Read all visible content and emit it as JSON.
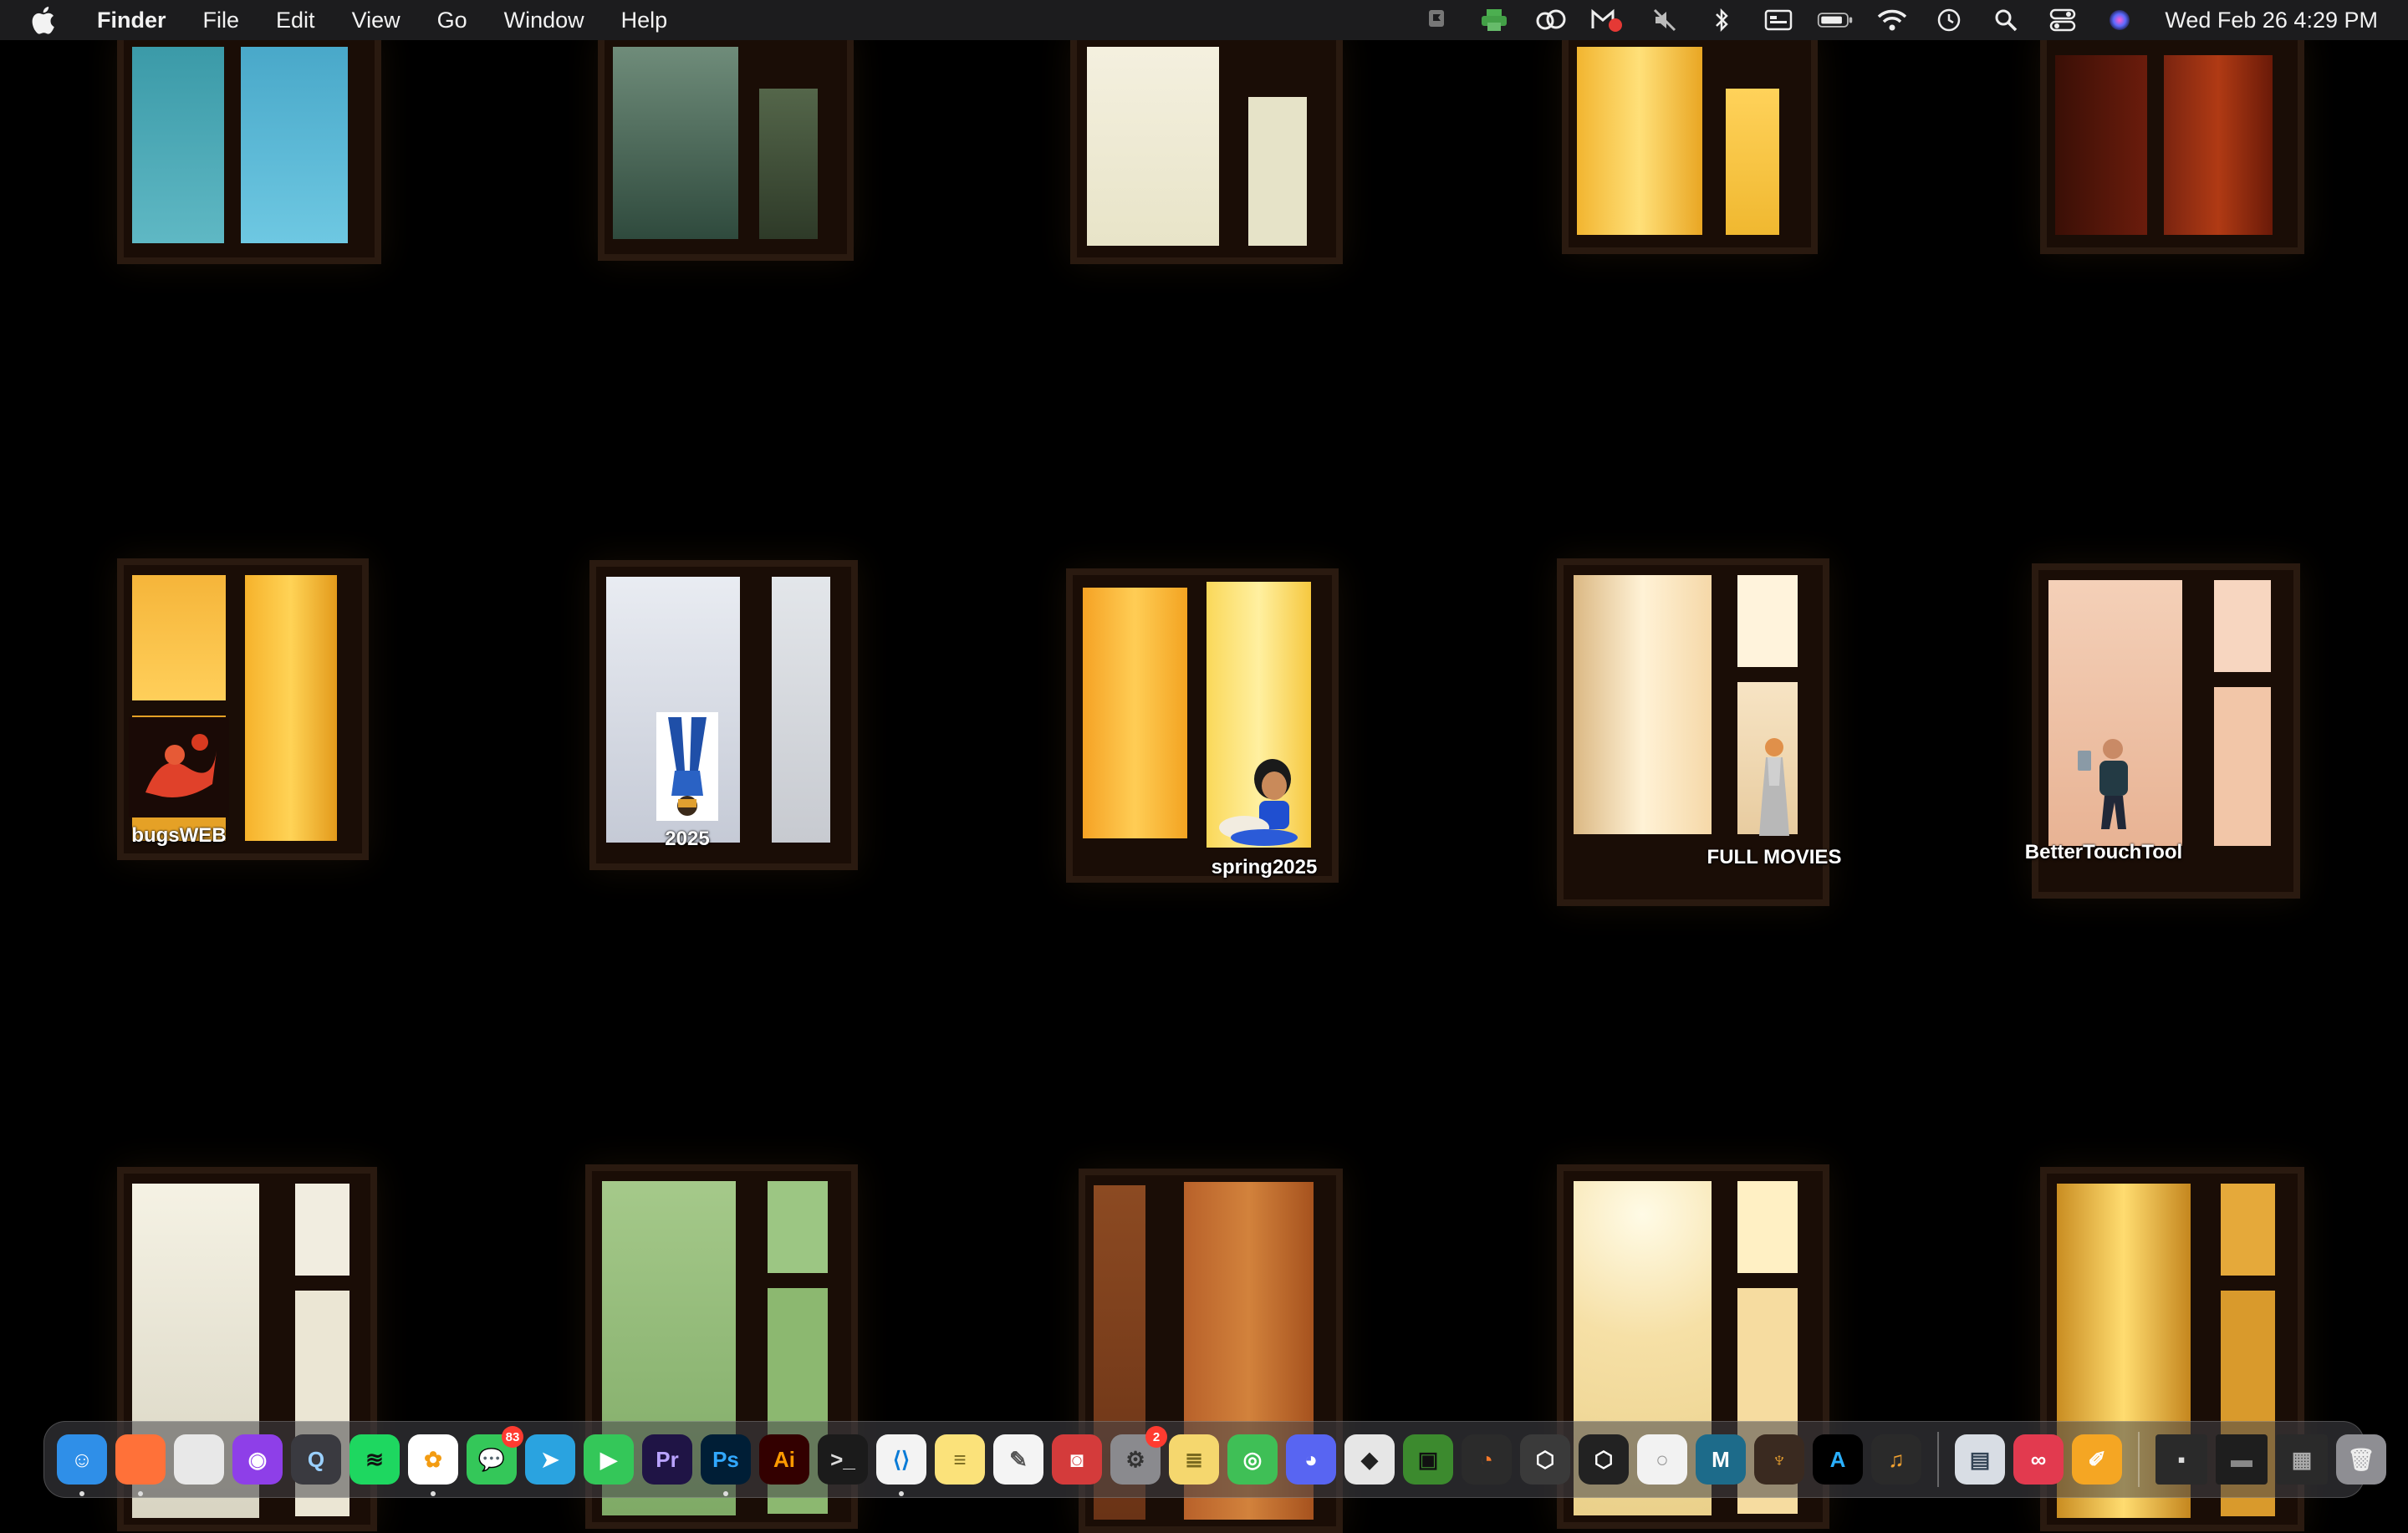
{
  "menubar": {
    "app_name": "Finder",
    "menus": [
      "File",
      "Edit",
      "View",
      "Go",
      "Window",
      "Help"
    ],
    "clock": "Wed Feb 26  4:29 PM",
    "status_icons": [
      "flag-icon",
      "printer-icon",
      "creative-cloud-icon",
      "gmail-badge-icon",
      "mute-icon",
      "bluetooth-icon",
      "display-icon",
      "battery-icon",
      "wifi-icon",
      "time-machine-icon",
      "spotlight-icon",
      "control-center-icon",
      "siri-icon"
    ]
  },
  "desktop": {
    "icons": [
      {
        "label": "bugsWEB"
      },
      {
        "label": "2025"
      },
      {
        "label": "spring2025"
      },
      {
        "label": "FULL MOVIES"
      },
      {
        "label": "BetterTouchTool"
      }
    ]
  },
  "dock": {
    "apps": [
      {
        "name": "finder-icon",
        "glyph": "☺",
        "bg": "#2f8fe8",
        "fg": "#fff",
        "running": true
      },
      {
        "name": "firefox-icon",
        "glyph": "",
        "bg": "#ff7139",
        "fg": "#fff",
        "running": true
      },
      {
        "name": "chrome-icon",
        "glyph": "",
        "bg": "#e8e8e8",
        "fg": "#fff",
        "running": false
      },
      {
        "name": "podcasts-icon",
        "glyph": "◉",
        "bg": "#8e3fe8",
        "fg": "#fff",
        "running": false
      },
      {
        "name": "quicktime-icon",
        "glyph": "Q",
        "bg": "#3a3a40",
        "fg": "#9ad0ff",
        "running": false
      },
      {
        "name": "spotify-icon",
        "glyph": "≋",
        "bg": "#1ed760",
        "fg": "#111",
        "running": false
      },
      {
        "name": "photos-icon",
        "glyph": "✿",
        "bg": "#ffffff",
        "fg": "#f39c12",
        "running": true
      },
      {
        "name": "messages-icon",
        "glyph": "💬",
        "bg": "#34c759",
        "fg": "#fff",
        "running": false,
        "badge": "83"
      },
      {
        "name": "telegram-icon",
        "glyph": "➤",
        "bg": "#2aa3e0",
        "fg": "#fff",
        "running": false
      },
      {
        "name": "facetime-icon",
        "glyph": "▶",
        "bg": "#34c759",
        "fg": "#fff",
        "running": false
      },
      {
        "name": "premiere-icon",
        "glyph": "Pr",
        "bg": "#1f1445",
        "fg": "#b9a3ff",
        "running": false
      },
      {
        "name": "photoshop-icon",
        "glyph": "Ps",
        "bg": "#001e36",
        "fg": "#31a8ff",
        "running": true
      },
      {
        "name": "illustrator-icon",
        "glyph": "Ai",
        "bg": "#330000",
        "fg": "#ff9a00",
        "running": false
      },
      {
        "name": "terminal-icon",
        "glyph": ">_",
        "bg": "#1b1b1b",
        "fg": "#ddd",
        "running": false
      },
      {
        "name": "vscode-icon",
        "glyph": "⟨⟩",
        "bg": "#f3f3f3",
        "fg": "#0a7bd6",
        "running": true
      },
      {
        "name": "notes-icon",
        "glyph": "≡",
        "bg": "#fbe27a",
        "fg": "#7a6a20",
        "running": false
      },
      {
        "name": "textedit-icon",
        "glyph": "✎",
        "bg": "#f4f4f4",
        "fg": "#555",
        "running": false
      },
      {
        "name": "photo-booth-icon",
        "glyph": "◙",
        "bg": "#d43b3b",
        "fg": "#fff",
        "running": false
      },
      {
        "name": "system-settings-icon",
        "glyph": "⚙",
        "bg": "#8a8a8e",
        "fg": "#333",
        "running": false,
        "badge": "2"
      },
      {
        "name": "stickies-icon",
        "glyph": "≣",
        "bg": "#f5d76e",
        "fg": "#7a6a20",
        "running": false
      },
      {
        "name": "find-my-icon",
        "glyph": "◎",
        "bg": "#3fbf56",
        "fg": "#fff",
        "running": false
      },
      {
        "name": "discord-icon",
        "glyph": "◕",
        "bg": "#5865f2",
        "fg": "#fff",
        "running": false
      },
      {
        "name": "roblox-icon",
        "glyph": "◆",
        "bg": "#e6e6e6",
        "fg": "#222",
        "running": false
      },
      {
        "name": "minecraft-icon",
        "glyph": "▣",
        "bg": "#3c8a2e",
        "fg": "#111",
        "running": false
      },
      {
        "name": "blender-icon",
        "glyph": "◔",
        "bg": "#2b2b2b",
        "fg": "#f5792a",
        "running": false
      },
      {
        "name": "unity-hub-icon",
        "glyph": "⬡",
        "bg": "#3a3a3a",
        "fg": "#fff",
        "running": false
      },
      {
        "name": "unity-icon",
        "glyph": "⬡",
        "bg": "#222",
        "fg": "#fff",
        "running": false
      },
      {
        "name": "capture-icon",
        "glyph": "○",
        "bg": "#f2f2f2",
        "fg": "#999",
        "running": false
      },
      {
        "name": "maya-icon",
        "glyph": "M",
        "bg": "#1d6b8a",
        "fg": "#fff",
        "running": false
      },
      {
        "name": "figure-app-icon",
        "glyph": "♆",
        "bg": "#3a2a20",
        "fg": "#e8a030",
        "running": false
      },
      {
        "name": "app-store-icon",
        "glyph": "A",
        "bg": "#000000",
        "fg": "#2ab0ff",
        "running": false
      },
      {
        "name": "garageband-icon",
        "glyph": "♫",
        "bg": "#2a2a2a",
        "fg": "#f0a030",
        "running": false
      }
    ],
    "apps_right": [
      {
        "name": "preview-icon",
        "glyph": "▤",
        "bg": "#d8dde4",
        "fg": "#345",
        "running": false
      },
      {
        "name": "creative-cloud-app-icon",
        "glyph": "∞",
        "bg": "#e23a4f",
        "fg": "#fff",
        "running": false
      },
      {
        "name": "pencil-app-icon",
        "glyph": "✐",
        "bg": "#f5a623",
        "fg": "#fff",
        "running": false
      }
    ],
    "minimized": [
      {
        "name": "minimized-photoshop-window-icon",
        "glyph": "▪",
        "bg": "#2a2a2a",
        "fg": "#ddd"
      },
      {
        "name": "minimized-vscode-window-icon",
        "glyph": "▬",
        "bg": "#1e1e1e",
        "fg": "#888"
      },
      {
        "name": "minimized-finder-window-icon",
        "glyph": "▦",
        "bg": "#2a2a2a",
        "fg": "#aaa"
      }
    ],
    "trash": {
      "name": "trash-icon",
      "glyph": "🗑",
      "bg": "#8e8e93",
      "fg": "#eee"
    }
  }
}
